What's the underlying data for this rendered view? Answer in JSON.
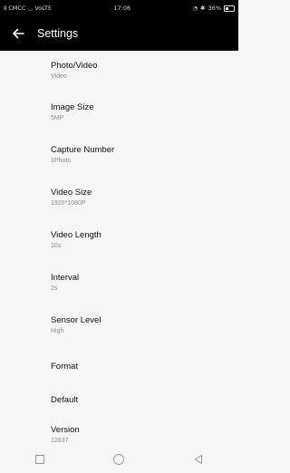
{
  "status_bar": {
    "carrier": "Ⅱ CMCC",
    "network": "VoLTE",
    "time": "17:06",
    "battery_text": "36%",
    "battery_level": 0.36
  },
  "app_bar": {
    "title": "Settings",
    "back_icon": "arrow-left-icon"
  },
  "settings": [
    {
      "id": "photo-video",
      "title": "Photo/Video",
      "value": "Video"
    },
    {
      "id": "image-size",
      "title": "Image Size",
      "value": "5MP"
    },
    {
      "id": "capture-number",
      "title": "Capture Number",
      "value": "1Photo"
    },
    {
      "id": "video-size",
      "title": "Video Size",
      "value": "1920*1080P"
    },
    {
      "id": "video-length",
      "title": "Video Length",
      "value": "10s"
    },
    {
      "id": "interval",
      "title": "Interval",
      "value": "2s"
    },
    {
      "id": "sensor-level",
      "title": "Sensor Level",
      "value": "High"
    },
    {
      "id": "format",
      "title": "Format",
      "value": ""
    },
    {
      "id": "default",
      "title": "Default",
      "value": ""
    },
    {
      "id": "version",
      "title": "Version",
      "value": "12837"
    }
  ],
  "nav_bar": {
    "recents_icon": "square-icon",
    "home_icon": "circle-icon",
    "back_icon": "triangle-back-icon"
  },
  "colors": {
    "app_bar": "#000000",
    "background": "#f5f5f5",
    "title_text": "#111111",
    "value_text": "#8a8a8a"
  }
}
